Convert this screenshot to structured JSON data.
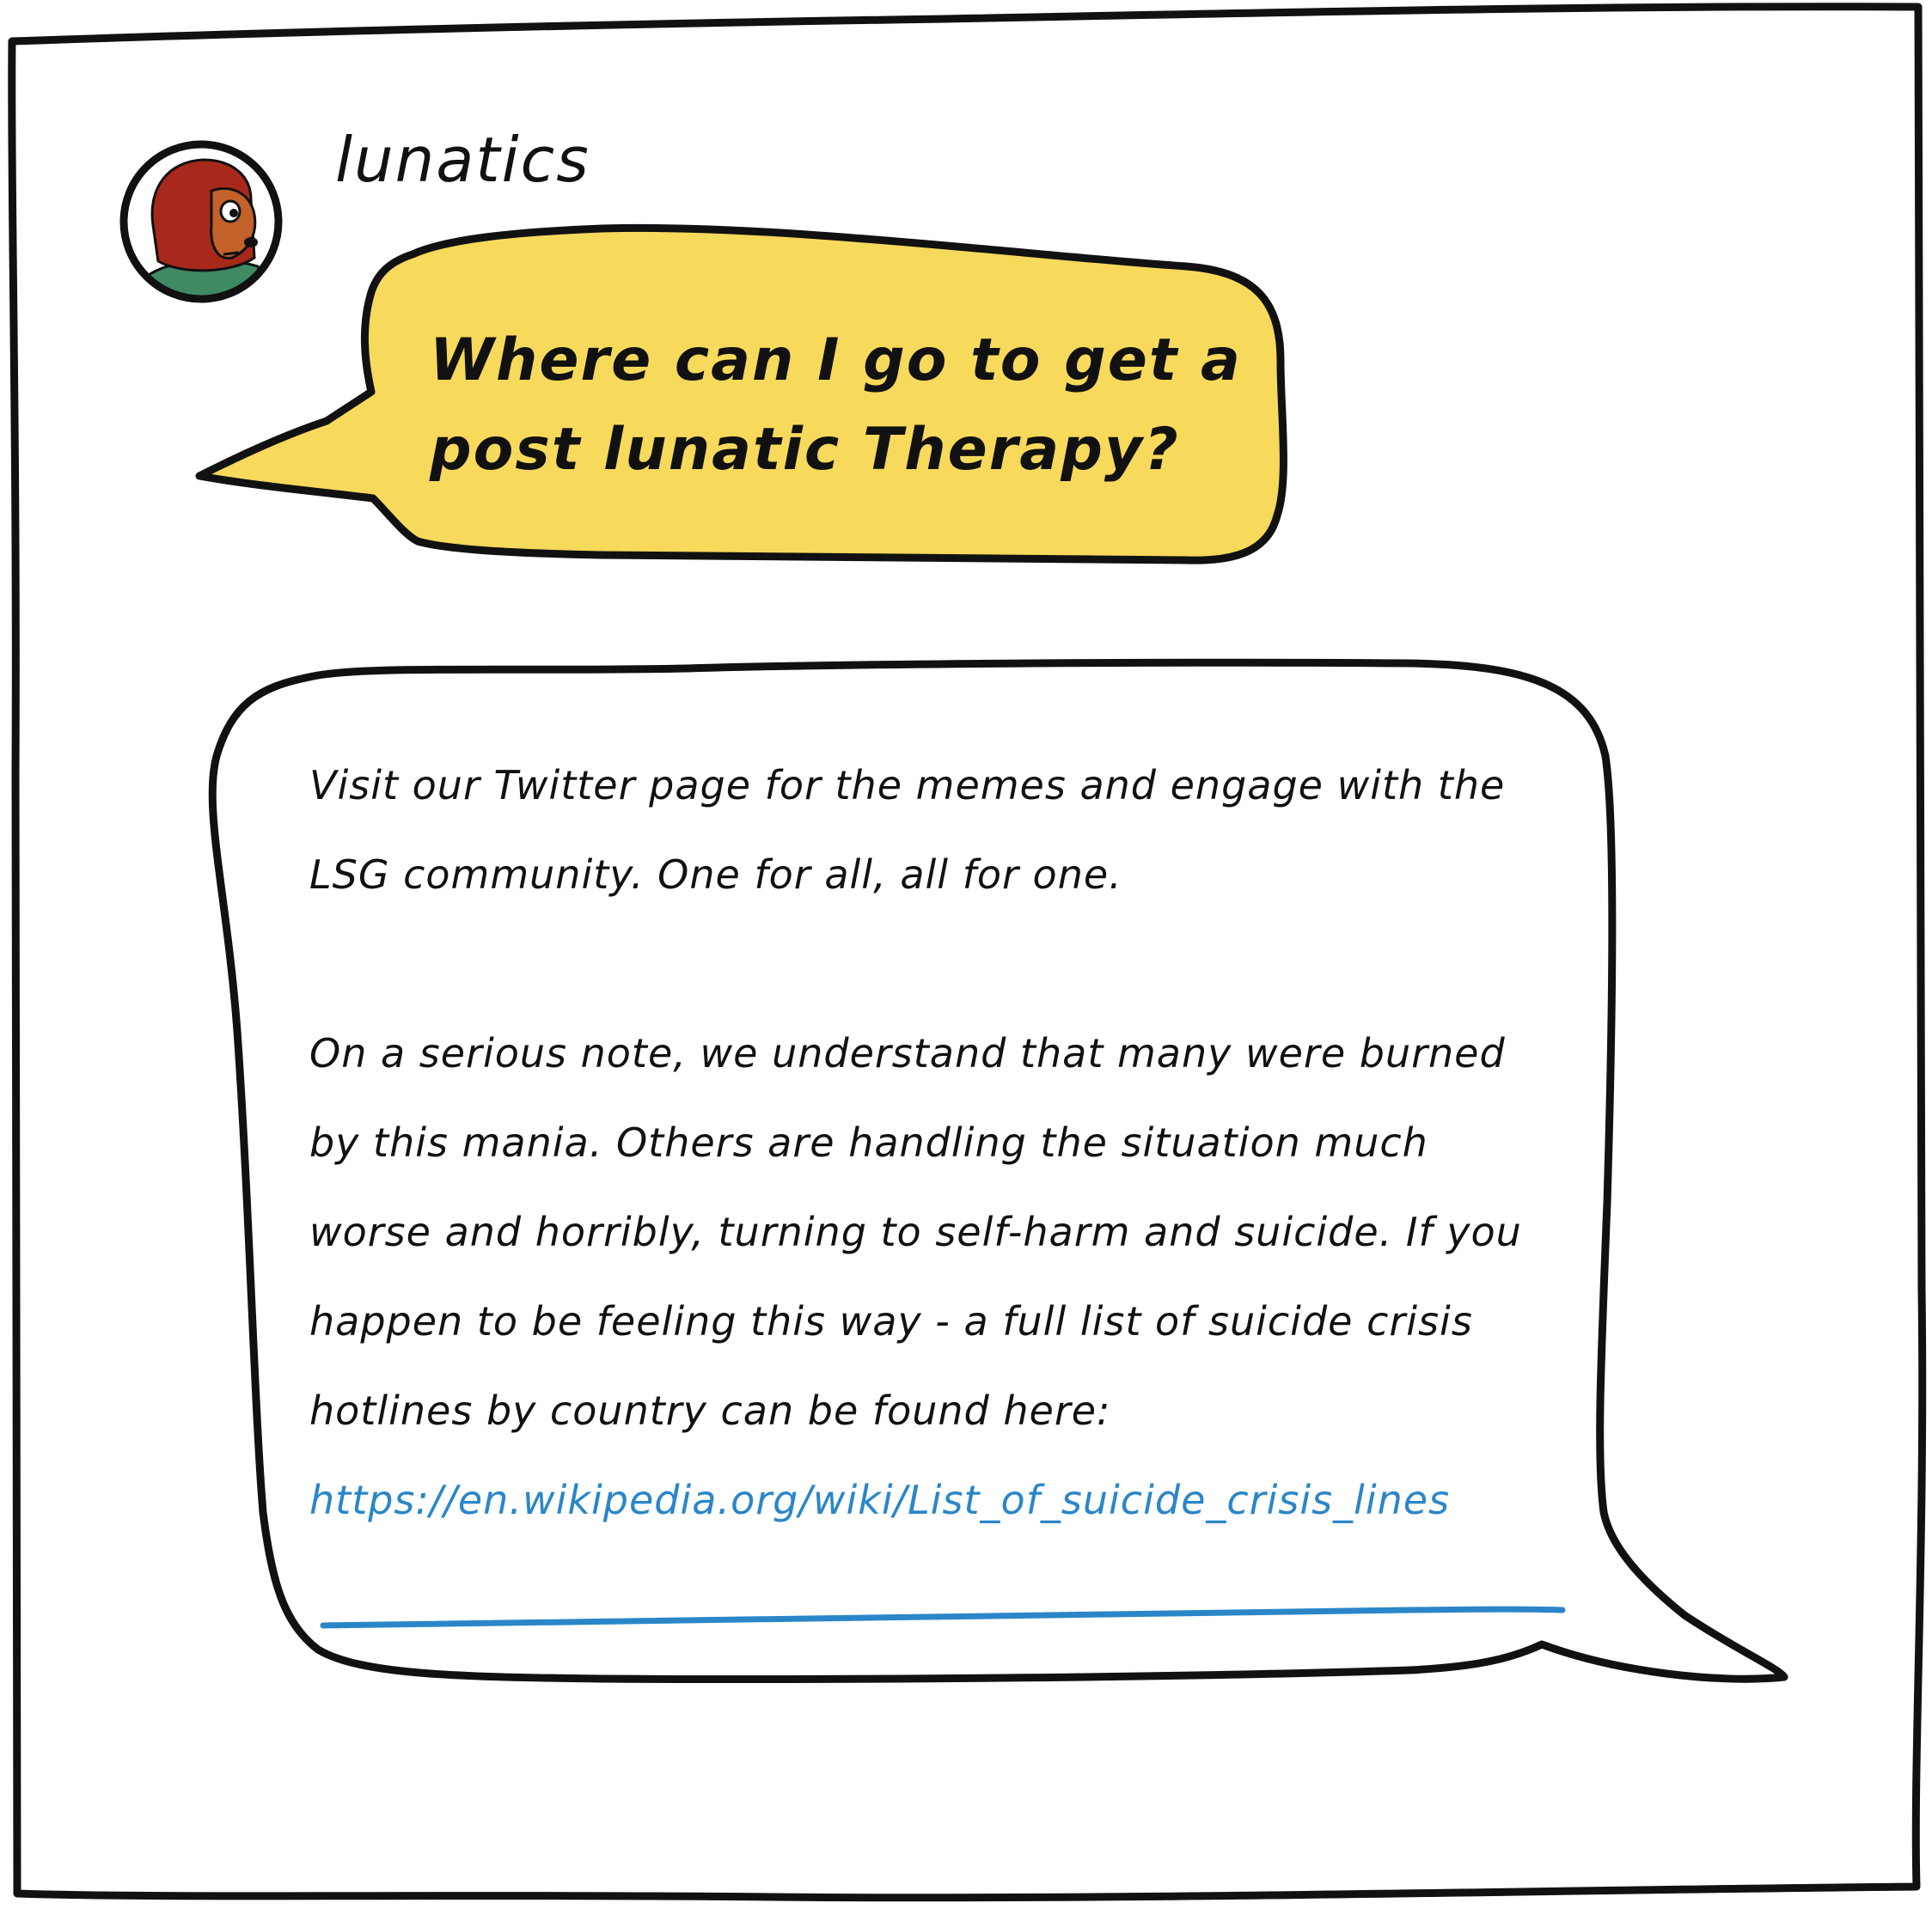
{
  "post": {
    "username": "lunatics",
    "avatar_icon": "monkey-puppet-avatar-icon",
    "question": "Where can I go to get a post lunatic Therapy?"
  },
  "reply": {
    "paragraph_1": "Visit our Twitter page for the memes and engage with the LSG community. One for all, all for one.",
    "paragraph_2": "On a serious note, we understand that many were burned by this mania. Others are handling the situation much worse and horribly, turning to self-harm and suicide. If you happen to be feeling this way - a full list of suicide crisis hotlines by country can be found here:",
    "link_text": "https://en.wikipedia.org/wiki/List_of_suicide_crisis_lines"
  },
  "colors": {
    "question_bubble": "#f7d95c",
    "reply_bubble": "#ffffff",
    "outline": "#111111",
    "link": "#2a86c8",
    "avatar_skin": "#c2622a",
    "avatar_hood": "#a8291c",
    "avatar_shirt": "#3f8a63"
  }
}
